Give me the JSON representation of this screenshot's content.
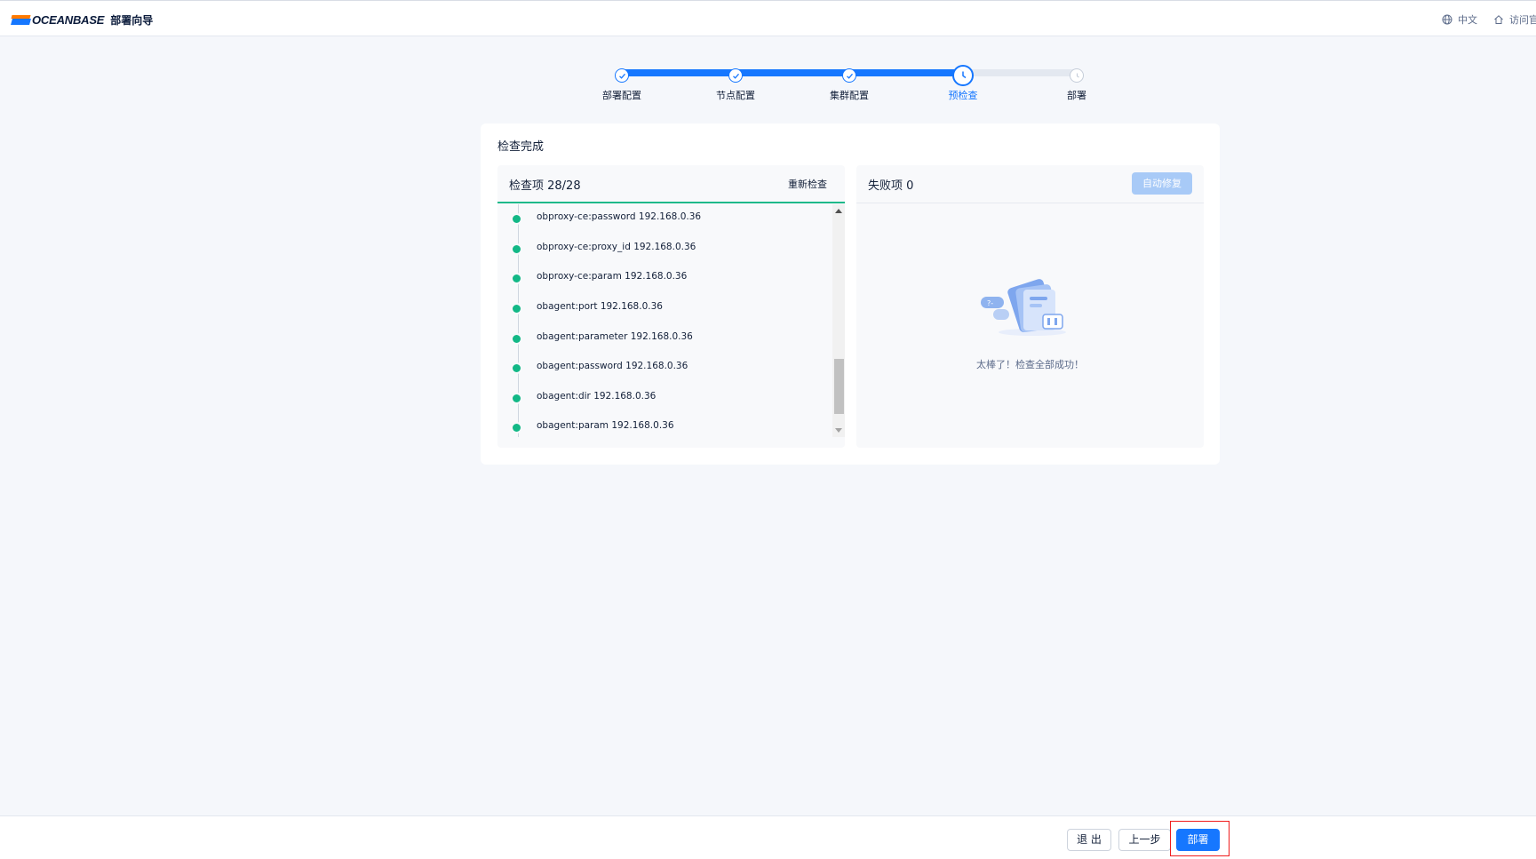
{
  "header": {
    "logo_text": "OCEANBASE",
    "app_title": "部署向导",
    "language_label": "中文",
    "visit_site_label": "访问官网"
  },
  "steps": [
    {
      "label": "部署配置",
      "state": "done"
    },
    {
      "label": "节点配置",
      "state": "done"
    },
    {
      "label": "集群配置",
      "state": "done"
    },
    {
      "label": "预检查",
      "state": "current"
    },
    {
      "label": "部署",
      "state": "pending"
    }
  ],
  "card": {
    "title": "检查完成",
    "check_panel": {
      "title": "检查项 28/28",
      "recheck_label": "重新检查",
      "items": [
        "obproxy-ce:password 192.168.0.36",
        "obproxy-ce:proxy_id 192.168.0.36",
        "obproxy-ce:param 192.168.0.36",
        "obagent:port 192.168.0.36",
        "obagent:parameter 192.168.0.36",
        "obagent:password 192.168.0.36",
        "obagent:dir 192.168.0.36",
        "obagent:param 192.168.0.36"
      ]
    },
    "fail_panel": {
      "title": "失败项 0",
      "auto_fix_label": "自动修复",
      "empty_text": "太棒了！检查全部成功！"
    }
  },
  "footer": {
    "exit_label": "退 出",
    "prev_label": "上一步",
    "deploy_label": "部署"
  },
  "colors": {
    "primary": "#1677ff",
    "success": "#12b886",
    "highlight": "#f01c1c"
  }
}
